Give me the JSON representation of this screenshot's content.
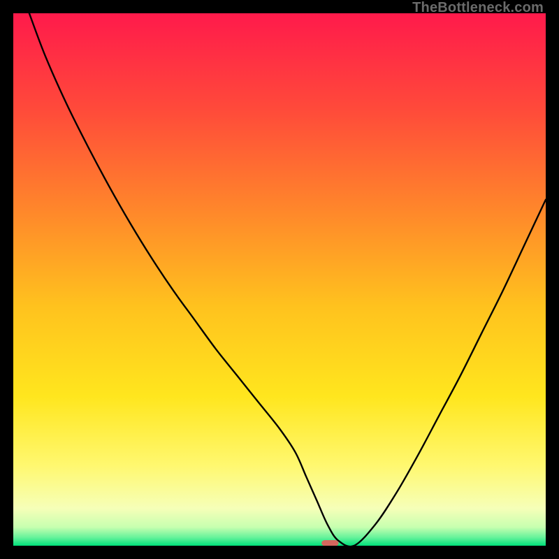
{
  "watermark": "TheBottleneck.com",
  "chart_data": {
    "type": "line",
    "title": "",
    "xlabel": "",
    "ylabel": "",
    "xlim": [
      0,
      100
    ],
    "ylim": [
      0,
      100
    ],
    "grid": false,
    "legend": false,
    "background_gradient": [
      {
        "offset": 0.0,
        "color": "#ff1a4b"
      },
      {
        "offset": 0.18,
        "color": "#ff4a3a"
      },
      {
        "offset": 0.38,
        "color": "#ff8a2a"
      },
      {
        "offset": 0.55,
        "color": "#ffc21e"
      },
      {
        "offset": 0.72,
        "color": "#ffe61e"
      },
      {
        "offset": 0.85,
        "color": "#fff870"
      },
      {
        "offset": 0.93,
        "color": "#f6ffb8"
      },
      {
        "offset": 0.965,
        "color": "#c7ffb0"
      },
      {
        "offset": 0.985,
        "color": "#63f29a"
      },
      {
        "offset": 1.0,
        "color": "#00e07a"
      }
    ],
    "series": [
      {
        "name": "bottleneck-curve",
        "x": [
          3,
          6,
          10,
          14,
          18,
          22,
          26,
          30,
          34,
          38,
          42,
          46,
          50,
          53,
          55,
          57,
          59,
          61,
          64,
          68,
          72,
          76,
          80,
          84,
          88,
          92,
          96,
          100
        ],
        "y": [
          100,
          92,
          83,
          75,
          67.5,
          60.5,
          54,
          48,
          42.5,
          37,
          32,
          27,
          22,
          17.5,
          13,
          8.5,
          4,
          1,
          0,
          4,
          10,
          17,
          24.5,
          32,
          40,
          48,
          56.5,
          65
        ]
      }
    ],
    "marker": {
      "name": "optimal-point",
      "x": 59.5,
      "y": 0.5,
      "width": 3.2,
      "height": 1.1,
      "color": "#d4675e"
    }
  }
}
